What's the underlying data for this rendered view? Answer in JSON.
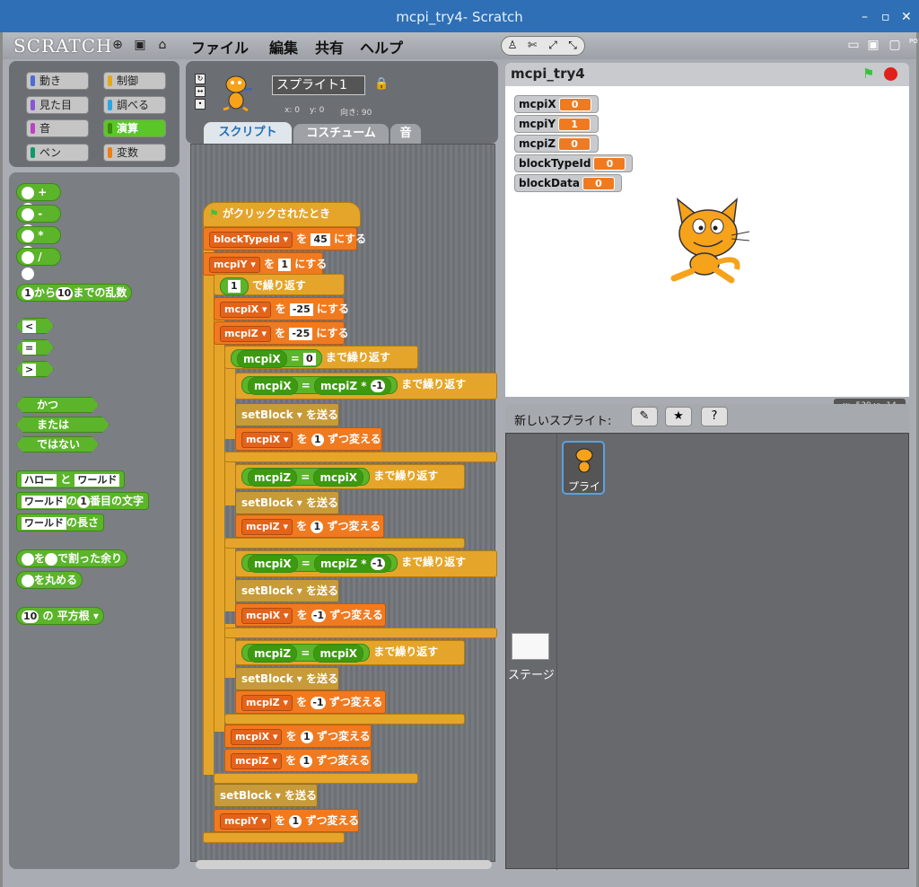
{
  "window": {
    "title": "mcpi_try4- Scratch",
    "min": "–",
    "max": "▫",
    "close": "✕"
  },
  "menubar": {
    "logo": "SCRATCH",
    "items": [
      "ファイル",
      "編集",
      "共有",
      "ヘルプ"
    ]
  },
  "categories": [
    {
      "label": "動き",
      "color": "#4a6cd4"
    },
    {
      "label": "制御",
      "color": "#e1a91a"
    },
    {
      "label": "見た目",
      "color": "#8a55d7"
    },
    {
      "label": "調べる",
      "color": "#2ca5e2"
    },
    {
      "label": "音",
      "color": "#bb42c3"
    },
    {
      "label": "演算",
      "color": "#5cb712"
    },
    {
      "label": "ペン",
      "color": "#0e9a6c"
    },
    {
      "label": "変数",
      "color": "#ee7d16"
    }
  ],
  "palette": {
    "ops": [
      "+",
      "-",
      "*",
      "/"
    ],
    "random": {
      "a": "1",
      "from": "から",
      "b": "10",
      "label": "までの乱数"
    },
    "cmp": [
      "<",
      "=",
      ">"
    ],
    "bool": [
      "かつ",
      "または",
      "ではない"
    ],
    "join": {
      "a": "ハロー",
      "and": "と",
      "b": "ワールド"
    },
    "letter": {
      "a": "ワールド",
      "of": "の",
      "n": "1",
      "label": "番目の文字"
    },
    "length": {
      "a": "ワールド",
      "label": "の長さ"
    },
    "mod": {
      "to": "を",
      "label": "で割った余り"
    },
    "round": "を丸める",
    "sqrt": {
      "n": "10",
      "of": "の",
      "fn": "平方根"
    }
  },
  "sprite": {
    "name": "スプライト1",
    "x": "x: 0",
    "y": "y: 0",
    "dir": "向き: 90"
  },
  "tabs": [
    "スクリプト",
    "コスチューム",
    "音"
  ],
  "script": {
    "hat": "がクリックされたとき",
    "lines": [
      {
        "v": "blockTypeId",
        "t": "を",
        "n": "45",
        "e": "にする"
      },
      {
        "v": "mcpiY",
        "t": "を",
        "n": "1",
        "e": "にする"
      },
      {
        "pre": "1",
        "e": "で繰り返す"
      },
      {
        "v": "mcpiX",
        "t": "を",
        "n": "-25",
        "e": "にする"
      },
      {
        "v": "mcpiZ",
        "t": "を",
        "n": "-25",
        "e": "にする"
      },
      {
        "c1": "mcpiX",
        "op": "=",
        "c2": "0",
        "e": "まで繰り返す"
      },
      {
        "c1": "mcpiX",
        "op": "=",
        "c2": "mcpiZ",
        "m": "*",
        "mn": "-1",
        "e": "まで繰り返す"
      },
      {
        "s": "setBlock",
        "e": "を送る"
      },
      {
        "v": "mcpiX",
        "t": "を",
        "n": "1",
        "e": "ずつ変える"
      },
      {
        "c1": "mcpiZ",
        "op": "=",
        "c2": "mcpiX",
        "e": "まで繰り返す"
      },
      {
        "s": "setBlock",
        "e": "を送る"
      },
      {
        "v": "mcpiZ",
        "t": "を",
        "n": "1",
        "e": "ずつ変える"
      },
      {
        "c1": "mcpiX",
        "op": "=",
        "c2": "mcpiZ",
        "m": "*",
        "mn": "-1",
        "e": "まで繰り返す"
      },
      {
        "s": "setBlock",
        "e": "を送る"
      },
      {
        "v": "mcpiX",
        "t": "を",
        "n": "-1",
        "e": "ずつ変える"
      },
      {
        "c1": "mcpiZ",
        "op": "=",
        "c2": "mcpiX",
        "e": "まで繰り返す"
      },
      {
        "s": "setBlock",
        "e": "を送る"
      },
      {
        "v": "mcpiZ",
        "t": "を",
        "n": "-1",
        "e": "ずつ変える"
      },
      {
        "v": "mcpiX",
        "t": "を",
        "n": "1",
        "e": "ずつ変える"
      },
      {
        "v": "mcpiZ",
        "t": "を",
        "n": "1",
        "e": "ずつ変える"
      },
      {
        "s": "setBlock",
        "e": "を送る"
      },
      {
        "v": "mcpiY",
        "t": "を",
        "n": "1",
        "e": "ずつ変える"
      }
    ]
  },
  "stage": {
    "title": "mcpi_try4",
    "monitors": [
      {
        "name": "mcpiX",
        "value": "0"
      },
      {
        "name": "mcpiY",
        "value": "1"
      },
      {
        "name": "mcpiZ",
        "value": "0"
      },
      {
        "name": "blockTypeId",
        "value": "0"
      },
      {
        "name": "blockData",
        "value": "0"
      }
    ],
    "coords": {
      "x": "x: -539",
      "y": "y: -14"
    }
  },
  "new_sprite": {
    "label": "新しいスプライト:"
  },
  "sprites": [
    {
      "name": "スプライト1",
      "short": "プライ"
    }
  ],
  "stage_thumb": {
    "label": "ステージ"
  },
  "right_edge": "PO",
  "colors": {
    "motion": "#4a6cd4",
    "control": "#e5a52a",
    "operators": "#5bb42a",
    "variables": "#f07a20"
  }
}
